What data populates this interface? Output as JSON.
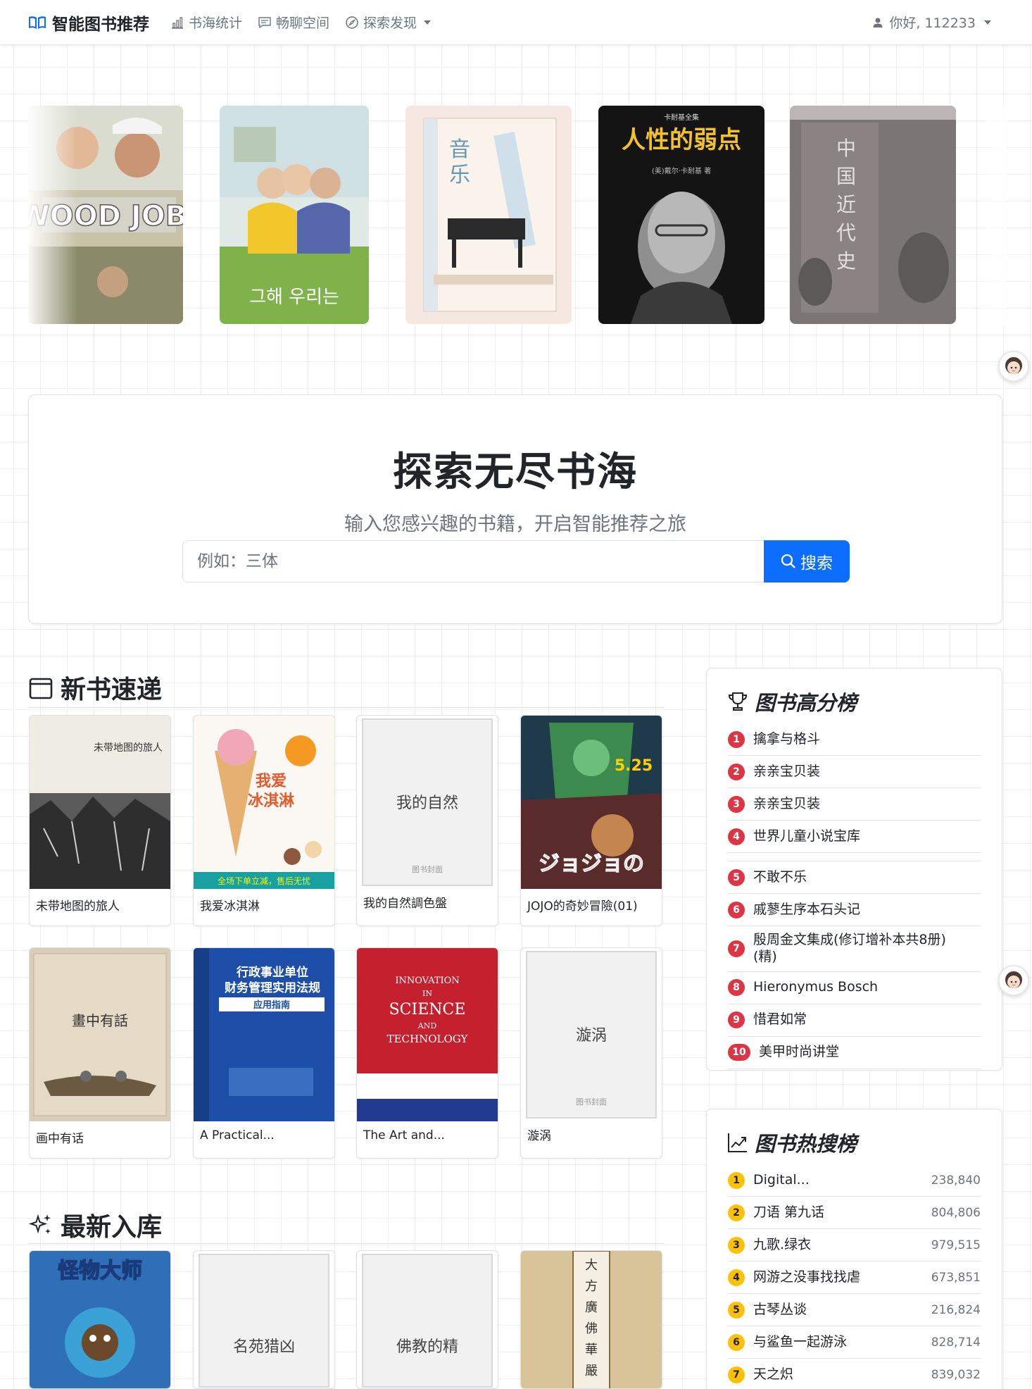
{
  "nav": {
    "brand": "智能图书推荐",
    "links": [
      {
        "label": "书海统计",
        "icon": "bar-chart-icon"
      },
      {
        "label": "畅聊空间",
        "icon": "chat-icon"
      },
      {
        "label": "探索发现",
        "icon": "compass-icon"
      }
    ],
    "user_greeting": "你好, 112233"
  },
  "carousel": [
    {
      "name": "wood-job-cover",
      "text": "WOOD JOB!"
    },
    {
      "name": "korean-drama-cover",
      "text": "그해 우리는"
    },
    {
      "name": "music-murakami-cover",
      "text": "音乐"
    },
    {
      "name": "carnegie-cover",
      "text": "人性的弱点"
    },
    {
      "name": "china-modern-history-cover",
      "text": "中国近代史"
    }
  ],
  "hero": {
    "title": "探索无尽书海",
    "subtitle": "输入您感兴趣的书籍，开启智能推荐之旅",
    "search_placeholder": "例如：三体",
    "search_button": "搜索"
  },
  "new_books": {
    "title": "新书速递",
    "books": [
      {
        "name": "未带地图的旅人",
        "cover_text": "未带地图的旅人"
      },
      {
        "name": "我爱冰淇淋",
        "cover_text": "我爱冰淇淋"
      },
      {
        "name": "我的自然調色盤",
        "placeholder": "我的自然",
        "placeholder_sub": "图书封面"
      },
      {
        "name": "JOJO的奇妙冒險(01)",
        "cover_text": "5.25"
      },
      {
        "name": "画中有话",
        "cover_text": "畫中有話"
      },
      {
        "name": "A Practical...",
        "cover_text": "行政事业单位财务管理实用法规"
      },
      {
        "name": "The Art and...",
        "cover_text": "INNOVATION IN SCIENCE AND TECHNOLOGY"
      },
      {
        "name": "漩涡",
        "placeholder": "漩涡",
        "placeholder_sub": "图书封面"
      }
    ]
  },
  "latest": {
    "title": "最新入库",
    "books": [
      {
        "name": "怪物大师",
        "cover_text": "怪物大师"
      },
      {
        "name": "名苑猎凶",
        "placeholder": "名苑猎凶"
      },
      {
        "name": "佛教的精",
        "placeholder": "佛教的精"
      },
      {
        "name": "大方廣佛華嚴經",
        "cover_text": "大方廣佛華嚴經"
      }
    ]
  },
  "top_rated": {
    "title": "图书高分榜",
    "items": [
      {
        "rank": "1",
        "name": "擒拿与格斗"
      },
      {
        "rank": "2",
        "name": "亲亲宝贝装"
      },
      {
        "rank": "3",
        "name": "亲亲宝贝装"
      },
      {
        "rank": "4",
        "name": "世界儿童小说宝库"
      },
      {
        "rank": "5",
        "name": "不敢不乐"
      },
      {
        "rank": "6",
        "name": "戚蓼生序本石头记"
      },
      {
        "rank": "7",
        "name": "殷周金文集成(修订增补本共8册)(精)"
      },
      {
        "rank": "8",
        "name": "Hieronymus Bosch"
      },
      {
        "rank": "9",
        "name": "惜君如常"
      },
      {
        "rank": "10",
        "name": "美甲时尚讲堂"
      }
    ]
  },
  "hot_search": {
    "title": "图书热搜榜",
    "items": [
      {
        "rank": "1",
        "name": "Digital...",
        "count": "238,840"
      },
      {
        "rank": "2",
        "name": "刀语 第九话",
        "count": "804,806"
      },
      {
        "rank": "3",
        "name": "九歌.绿衣",
        "count": "979,515"
      },
      {
        "rank": "4",
        "name": "网游之没事找找虐",
        "count": "673,851"
      },
      {
        "rank": "5",
        "name": "古琴丛谈",
        "count": "216,824"
      },
      {
        "rank": "6",
        "name": "与鲨鱼一起游泳",
        "count": "828,714"
      },
      {
        "rank": "7",
        "name": "天之炽",
        "count": "839,032"
      }
    ]
  },
  "colors": {
    "primary": "#0d6efd",
    "rank_red": "#dc3545",
    "rank_yellow": "#ffc107"
  }
}
